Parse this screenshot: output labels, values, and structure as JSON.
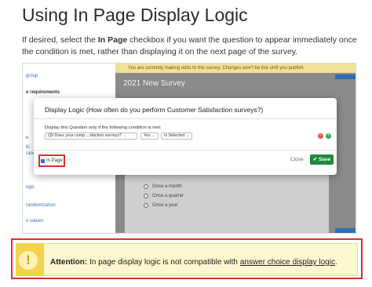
{
  "page": {
    "title": "Using In Page Display Logic",
    "intro": {
      "part1": "If desired, select the ",
      "bold": "In Page",
      "part2": " checkbox if you want the question to appear immediately once the condition is met, rather than displaying it on the next page of the survey."
    }
  },
  "screenshot": {
    "sidebar": {
      "items": [
        {
          "label": "group",
          "style": "link"
        },
        {
          "label": "e requirements",
          "style": "dark"
        },
        {
          "label": "e",
          "style": "link"
        },
        {
          "label": "bi",
          "style": "link"
        },
        {
          "label": "ranc",
          "style": "link"
        },
        {
          "label": "ogic",
          "style": "link"
        },
        {
          "label": "randomization",
          "style": "link"
        },
        {
          "label": "n values",
          "style": "link"
        }
      ]
    },
    "banner_text": "You are currently making edits to this survey. Changes won't be live until you publish.",
    "survey_title": "2021 New Survey",
    "answer_options": [
      "Once a month",
      "Once a quarter",
      "Once a year"
    ],
    "modal": {
      "title": "Display Logic (How often do you perform Customer Satisfaction surveys?)",
      "condition_label": "Display this Question only if the following condition is met:",
      "question_select": "Q9 Does your comp....sfaction surveys?",
      "answer_select": "Yes",
      "operator_select": "Is Selected",
      "in_page_label": "In Page",
      "close_label": "Close",
      "save_label": "Save"
    }
  },
  "attention": {
    "label": "Attention:",
    "text": " In page display logic is not compatible with ",
    "link": "answer choice display logic",
    "end": "."
  },
  "colors": {
    "highlight_red": "#d9312b",
    "save_green": "#1d8a3c",
    "attention_yellow": "#f1d44c",
    "link_blue": "#3a6fb7"
  }
}
